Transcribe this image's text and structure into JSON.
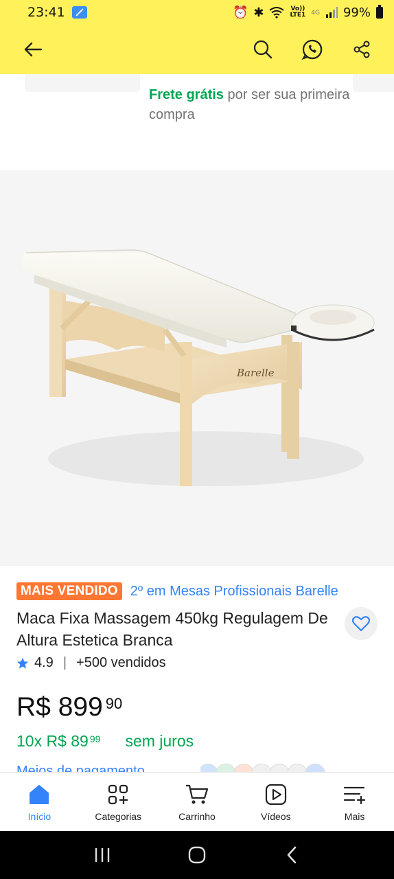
{
  "status_bar": {
    "time": "23:41",
    "network": "Vo))\nLTE1",
    "net_gen": "4G",
    "battery": "99%"
  },
  "app_bar": {
    "icons": [
      "back-arrow-icon",
      "search-icon",
      "whatsapp-icon",
      "share-icon"
    ]
  },
  "shipping": {
    "free_label": "Frete grátis",
    "rest": " por ser sua primeira compra"
  },
  "product": {
    "brand_on_image": "Barelle",
    "badge": "MAIS VENDIDO",
    "ranking": "2º em Mesas Profissionais Barelle",
    "title": "Maca Fixa Massagem 450kg Regulagem De Altura Estetica Branca",
    "rating": "4.9",
    "sold": "+500 vendidos",
    "price_main": "R$ 899",
    "price_cents": "90",
    "installments_main": "10x R$ 89",
    "installments_cents": "99",
    "no_interest": "sem juros",
    "payment_link": "Meios de pagamento"
  },
  "bottom_nav": [
    {
      "label": "Início",
      "icon": "home-icon",
      "active": true
    },
    {
      "label": "Categorias",
      "icon": "categories-icon",
      "active": false
    },
    {
      "label": "Carrinho",
      "icon": "cart-icon",
      "active": false
    },
    {
      "label": "Vídeos",
      "icon": "video-icon",
      "active": false
    },
    {
      "label": "Mais",
      "icon": "more-icon",
      "active": false
    }
  ],
  "colors": {
    "brand_yellow": "#fff159",
    "green": "#00a650",
    "blue": "#3483fa",
    "badge_orange": "#ff7733"
  }
}
